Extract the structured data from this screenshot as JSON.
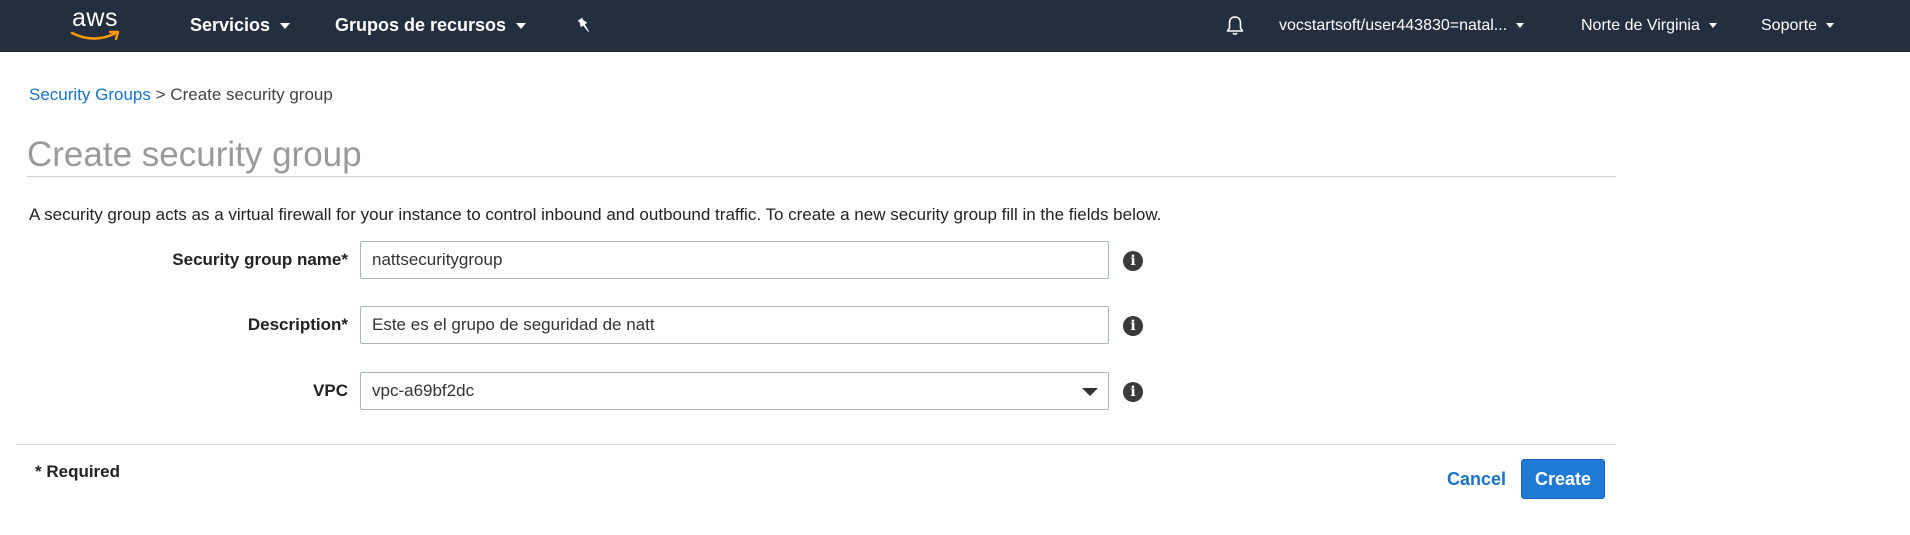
{
  "nav": {
    "logo_text": "aws",
    "services": "Servicios",
    "resource_groups": "Grupos de recursos",
    "pin_icon": "pushpin-icon",
    "bell_icon": "bell-icon",
    "account": "vocstartsoft/user443830=natal...",
    "region": "Norte de Virginia",
    "support": "Soporte",
    "bg_color": "#232f3e",
    "logo_accent": "#ff9900"
  },
  "breadcrumb": {
    "link": "Security Groups",
    "separator": ">",
    "current": "Create security group"
  },
  "page": {
    "title": "Create security group",
    "intro": "A security group acts as a virtual firewall for your instance to control inbound and outbound traffic. To create a new security group fill in the fields below."
  },
  "form": {
    "name_label": "Security group name*",
    "name_value": "nattsecuritygroup",
    "description_label": "Description*",
    "description_value": "Este es el grupo de seguridad de natt",
    "vpc_label": "VPC",
    "vpc_value": "vpc-a69bf2dc",
    "info_icon": "info-icon"
  },
  "footer": {
    "required_note": "* Required",
    "cancel_label": "Cancel",
    "create_label": "Create",
    "primary_color": "#1f7ad6",
    "link_color": "#1a72c9"
  }
}
